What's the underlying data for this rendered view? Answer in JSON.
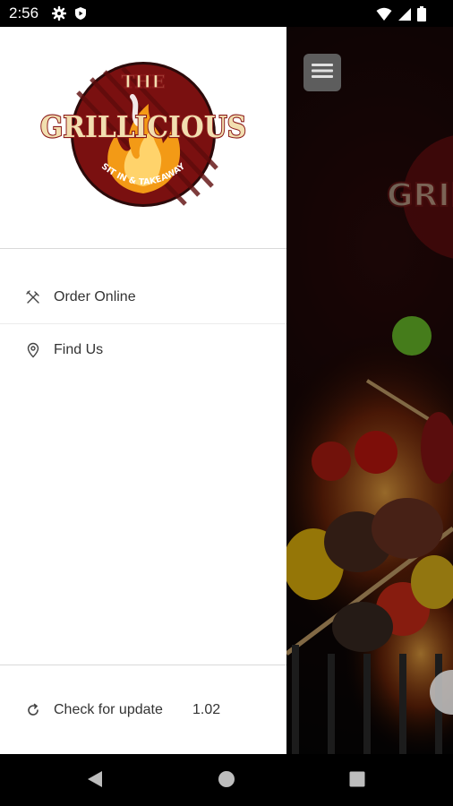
{
  "status_bar": {
    "time": "2:56",
    "left_icons": [
      "gear-icon",
      "play-shield-icon"
    ],
    "right_icons": [
      "wifi-icon",
      "signal-icon",
      "battery-icon"
    ]
  },
  "drawer": {
    "logo": {
      "top_word": "THE",
      "brand_name": "GRILLICIOUS",
      "tagline": "SIT IN & TAKEAWAY",
      "colors": {
        "ring": "#7a1010",
        "center": "#f7a21b",
        "text_fill": "#f2dfb0",
        "text_stroke": "#8b1a1a"
      }
    },
    "menu": [
      {
        "id": "order-online",
        "label": "Order Online",
        "icon": "cutlery-icon"
      },
      {
        "id": "find-us",
        "label": "Find Us",
        "icon": "map-pin-icon"
      }
    ],
    "footer": {
      "label": "Check for update",
      "version": "1.02",
      "icon": "refresh-icon"
    }
  },
  "background": {
    "menu_button_icon": "hamburger-icon",
    "partial_brand_text": "GRIL"
  },
  "nav_bar": {
    "buttons": [
      "back-icon",
      "home-icon",
      "recents-icon"
    ]
  },
  "colors": {
    "drawer_bg": "#ffffff",
    "divider": "#d9d9d9",
    "text": "#333333",
    "bar_bg": "#000000"
  }
}
